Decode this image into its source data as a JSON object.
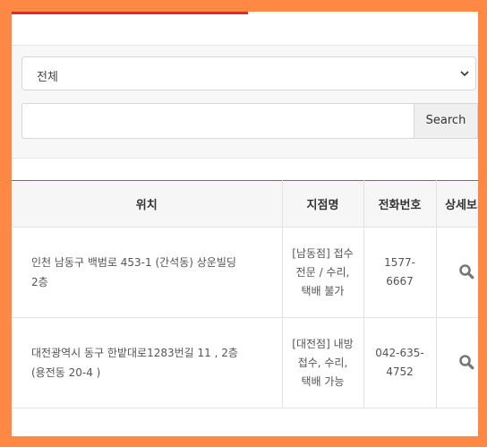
{
  "filter": {
    "select_value": "전체",
    "search_button_label": "Search",
    "search_value": ""
  },
  "table": {
    "headers": {
      "location": "위치",
      "branch": "지점명",
      "phone": "전화번호",
      "detail": "상세보기"
    },
    "rows": [
      {
        "address_line1": "인천 남동구 백범로 453-1 (간석동) 상운빌딩",
        "address_line2": "2층",
        "branch_line1": "[남동점] 접수",
        "branch_line2": "전문 / 수리,",
        "branch_line3": "택배 불가",
        "phone_line1": "1577-",
        "phone_line2": "6667"
      },
      {
        "address_line1": "대전광역시 동구 한밭대로1283번길 11 , 2층",
        "address_line2": "(용전동 20-4 )",
        "branch_line1": "[대전점] 내방",
        "branch_line2": "접수, 수리,",
        "branch_line3": "택배 가능",
        "phone_line1": "042-635-",
        "phone_line2": "4752"
      }
    ]
  },
  "colors": {
    "page_border": "#ff8845",
    "accent_red": "#e8262c",
    "icon_gray": "#777777"
  }
}
